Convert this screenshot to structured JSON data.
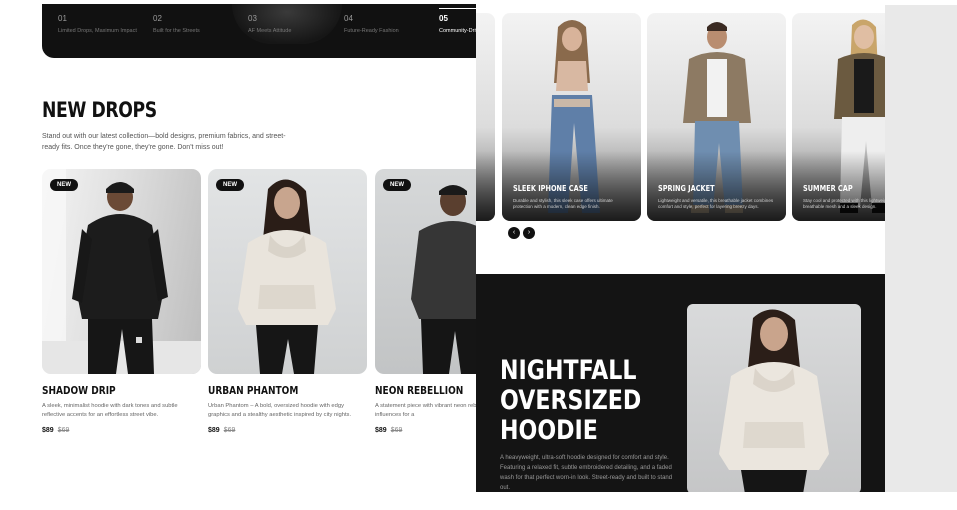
{
  "steps": [
    {
      "num": "01",
      "label": "Limited Drops, Maximum Impact"
    },
    {
      "num": "02",
      "label": "Built for the Streets"
    },
    {
      "num": "03",
      "label": "AF Meets Attitude"
    },
    {
      "num": "04",
      "label": "Future-Ready Fashion"
    },
    {
      "num": "05",
      "label": "Community-Driven"
    }
  ],
  "new_drops": {
    "title": "NEW DROPS",
    "description": "Stand out with our latest collection—bold designs, premium fabrics, and street-ready fits. Once they're gone, they're gone. Don't miss out!",
    "products": [
      {
        "badge": "NEW",
        "name": "SHADOW DRIP",
        "description": "A sleek, minimalist hoodie with dark tones and subtle reflective accents for an effortless street vibe.",
        "price": "$89",
        "old_price": "$69"
      },
      {
        "badge": "NEW",
        "name": "URBAN PHANTOM",
        "description": "Urban Phantom – A bold, oversized hoodie with edgy graphics and a stealthy aesthetic inspired by city nights.",
        "price": "$89",
        "old_price": "$69"
      },
      {
        "badge": "NEW",
        "name": "NEON REBELLION",
        "description": "A statement piece with vibrant neon rebellious street art influences for a",
        "price": "$89",
        "old_price": "$69"
      }
    ]
  },
  "carousel": {
    "items": [
      {
        "title": "SLEEK IPHONE CASE",
        "text": "Durable and stylish, this sleek case offers ultimate protection with a modern, clean edge finish."
      },
      {
        "title": "SPRING JACKET",
        "text": "Lightweight and versatile, this breathable jacket combines comfort and style, perfect for layering breezy days."
      },
      {
        "title": "SUMMER CAP",
        "text": "Stay cool and protected with this lightweight cap, featuring breathable mesh and a sleek design."
      }
    ],
    "prev_icon": "chevron-left-icon",
    "next_icon": "chevron-right-icon"
  },
  "hero": {
    "title_lines": [
      "NIGHTFALL",
      "OVERSIZED",
      "HOODIE"
    ],
    "description": "A heavyweight, ultra-soft hoodie designed for comfort and style. Featuring a relaxed fit, subtle embroidered detailing, and a faded wash for that perfect worn-in look. Street-ready and built to stand out."
  },
  "colors": {
    "dark": "#111111",
    "dark_section": "#141414",
    "gutter": "#e9e9e9",
    "accent_text": "#ffffff"
  }
}
